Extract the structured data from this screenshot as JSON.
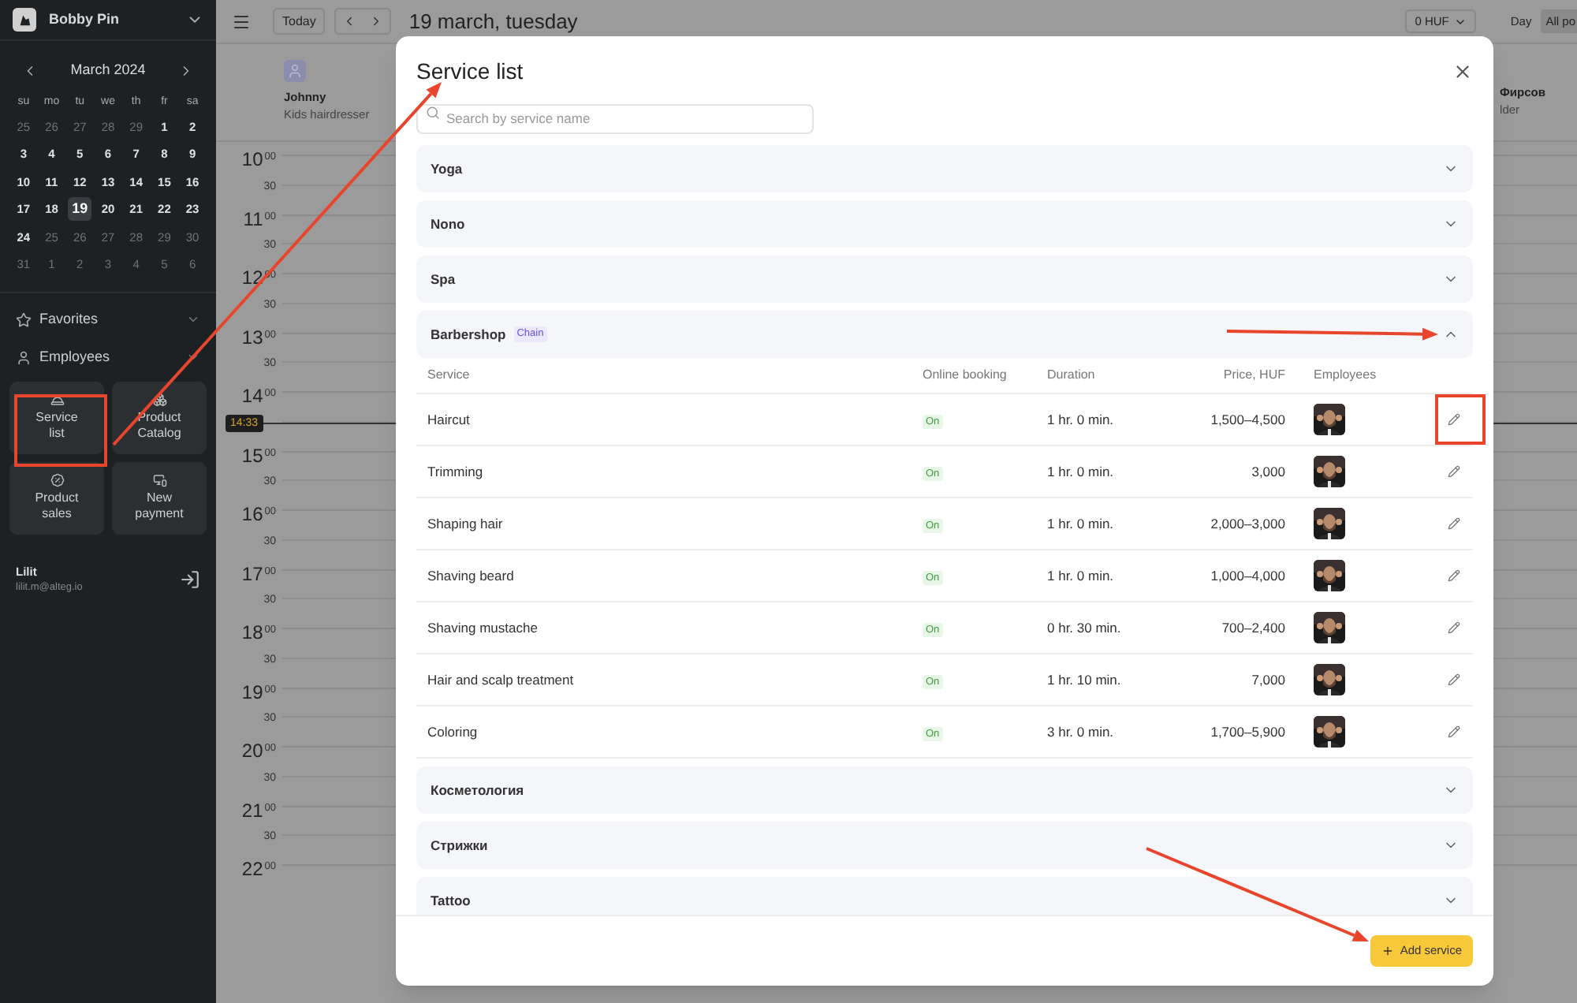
{
  "sidebar": {
    "account": "Bobby Pin",
    "calendar": {
      "month": "March 2024",
      "weekdays": [
        "su",
        "mo",
        "tu",
        "we",
        "th",
        "fr",
        "sa"
      ],
      "days": [
        {
          "label": "25",
          "muted": true,
          "selected": false
        },
        {
          "label": "26",
          "muted": true,
          "selected": false
        },
        {
          "label": "27",
          "muted": true,
          "selected": false
        },
        {
          "label": "28",
          "muted": true,
          "selected": false
        },
        {
          "label": "29",
          "muted": true,
          "selected": false
        },
        {
          "label": "1",
          "muted": false,
          "selected": false
        },
        {
          "label": "2",
          "muted": false,
          "selected": false
        },
        {
          "label": "3",
          "muted": false,
          "selected": false
        },
        {
          "label": "4",
          "muted": false,
          "selected": false
        },
        {
          "label": "5",
          "muted": false,
          "selected": false
        },
        {
          "label": "6",
          "muted": false,
          "selected": false
        },
        {
          "label": "7",
          "muted": false,
          "selected": false
        },
        {
          "label": "8",
          "muted": false,
          "selected": false
        },
        {
          "label": "9",
          "muted": false,
          "selected": false
        },
        {
          "label": "10",
          "muted": false,
          "selected": false
        },
        {
          "label": "11",
          "muted": false,
          "selected": false
        },
        {
          "label": "12",
          "muted": false,
          "selected": false
        },
        {
          "label": "13",
          "muted": false,
          "selected": false
        },
        {
          "label": "14",
          "muted": false,
          "selected": false
        },
        {
          "label": "15",
          "muted": false,
          "selected": false
        },
        {
          "label": "16",
          "muted": false,
          "selected": false
        },
        {
          "label": "17",
          "muted": false,
          "selected": false
        },
        {
          "label": "18",
          "muted": false,
          "selected": false
        },
        {
          "label": "19",
          "muted": false,
          "selected": true
        },
        {
          "label": "20",
          "muted": false,
          "selected": false
        },
        {
          "label": "21",
          "muted": false,
          "selected": false
        },
        {
          "label": "22",
          "muted": false,
          "selected": false
        },
        {
          "label": "23",
          "muted": false,
          "selected": false
        },
        {
          "label": "24",
          "muted": false,
          "selected": false
        },
        {
          "label": "25",
          "muted": true,
          "selected": false
        },
        {
          "label": "26",
          "muted": true,
          "selected": false
        },
        {
          "label": "27",
          "muted": true,
          "selected": false
        },
        {
          "label": "28",
          "muted": true,
          "selected": false
        },
        {
          "label": "29",
          "muted": true,
          "selected": false
        },
        {
          "label": "30",
          "muted": true,
          "selected": false
        },
        {
          "label": "31",
          "muted": true,
          "selected": false
        },
        {
          "label": "1",
          "muted": true,
          "selected": false
        },
        {
          "label": "2",
          "muted": true,
          "selected": false
        },
        {
          "label": "3",
          "muted": true,
          "selected": false
        },
        {
          "label": "4",
          "muted": true,
          "selected": false
        },
        {
          "label": "5",
          "muted": true,
          "selected": false
        },
        {
          "label": "6",
          "muted": true,
          "selected": false
        }
      ]
    },
    "sections": [
      "Favorites",
      "Employees"
    ],
    "tiles": [
      "Service list",
      "Product Catalog",
      "Product sales",
      "New payment"
    ],
    "user": {
      "name": "Lilit",
      "email": "lilit.m@alteg.io"
    }
  },
  "toolbar": {
    "today": "Today",
    "date": "19 march, tuesday",
    "currency": "0 HUF",
    "view": "Day",
    "filter": "All po"
  },
  "staff": [
    {
      "name": "Johnny",
      "role": "Kids hairdresser"
    },
    {
      "name": "Фирсов",
      "role": "lder"
    }
  ],
  "times": [
    {
      "hour": "10",
      "minute": "00",
      "half": "30"
    },
    {
      "hour": "11",
      "minute": "00",
      "half": "30"
    },
    {
      "hour": "12",
      "minute": "00",
      "half": "30"
    },
    {
      "hour": "13",
      "minute": "00",
      "half": "30"
    },
    {
      "hour": "14",
      "minute": "00"
    },
    {
      "hour": "15",
      "minute": "00",
      "half": "30"
    },
    {
      "hour": "16",
      "minute": "00",
      "half": "30"
    },
    {
      "hour": "17",
      "minute": "00",
      "half": "30"
    },
    {
      "hour": "18",
      "minute": "00",
      "half": "30"
    },
    {
      "hour": "19",
      "minute": "00",
      "half": "30"
    },
    {
      "hour": "20",
      "minute": "00",
      "half": "30"
    },
    {
      "hour": "21",
      "minute": "00",
      "half": "30"
    },
    {
      "hour": "22",
      "minute": "00"
    }
  ],
  "now": "14:33",
  "modal": {
    "title": "Service list",
    "search": {
      "placeholder": "Search by service name"
    },
    "groups": [
      {
        "name": "Yoga",
        "expanded": false
      },
      {
        "name": "Nono",
        "expanded": false
      },
      {
        "name": "Spa",
        "expanded": false
      },
      {
        "name": "Barbershop",
        "badge": "Chain",
        "expanded": true,
        "columns": [
          "Service",
          "Online booking",
          "Duration",
          "Price, HUF",
          "Employees"
        ],
        "rows": [
          {
            "service": "Haircut",
            "online": "On",
            "duration": "1 hr. 0 min.",
            "price": "1,500–4,500"
          },
          {
            "service": "Trimming",
            "online": "On",
            "duration": "1 hr. 0 min.",
            "price": "3,000"
          },
          {
            "service": "Shaping hair",
            "online": "On",
            "duration": "1 hr. 0 min.",
            "price": "2,000–3,000"
          },
          {
            "service": "Shaving beard",
            "online": "On",
            "duration": "1 hr. 0 min.",
            "price": "1,000–4,000"
          },
          {
            "service": "Shaving mustache",
            "online": "On",
            "duration": "0 hr. 30 min.",
            "price": "700–2,400"
          },
          {
            "service": "Hair and scalp treatment",
            "online": "On",
            "duration": "1 hr. 10 min.",
            "price": "7,000"
          },
          {
            "service": "Coloring",
            "online": "On",
            "duration": "3 hr. 0 min.",
            "price": "1,700–5,900"
          }
        ]
      },
      {
        "name": "Косметология",
        "expanded": false
      },
      {
        "name": "Стрижки",
        "expanded": false
      },
      {
        "name": "Tattoo",
        "expanded": false
      }
    ],
    "add": "Add service"
  }
}
